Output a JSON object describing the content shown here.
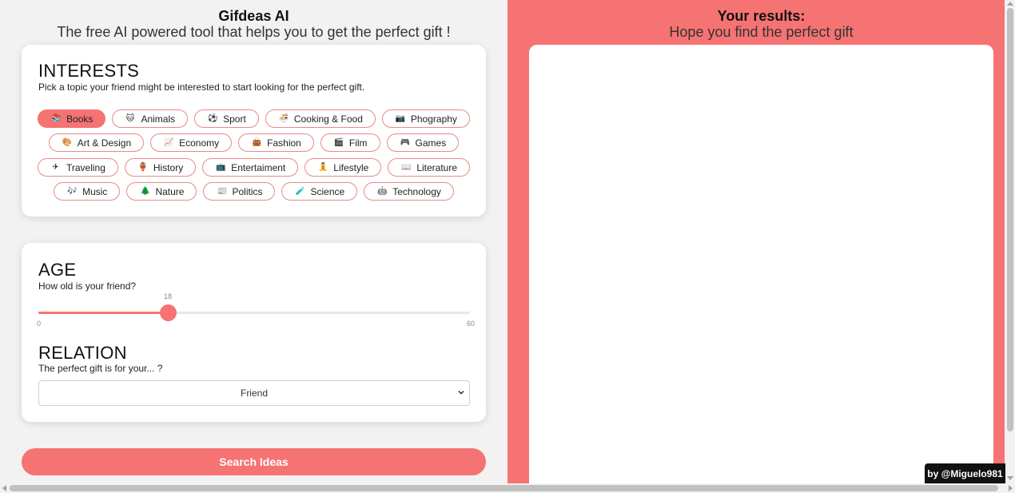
{
  "app": {
    "title": "Gifdeas AI",
    "subtitle": "The free AI powered tool that helps you to get the perfect gift !"
  },
  "interests": {
    "title": "INTERESTS",
    "description": "Pick a topic your friend might be interested to start looking for the perfect gift.",
    "rows": [
      [
        {
          "label": "Books",
          "icon": "books-icon",
          "glyph": "📚",
          "selected": true
        },
        {
          "label": "Animals",
          "icon": "cat-icon",
          "glyph": "🐱",
          "selected": false
        },
        {
          "label": "Sport",
          "icon": "soccer-ball-icon",
          "glyph": "⚽",
          "selected": false
        },
        {
          "label": "Cooking & Food",
          "icon": "food-bowl-icon",
          "glyph": "🍜",
          "selected": false
        },
        {
          "label": "Phography",
          "icon": "camera-icon",
          "glyph": "📷",
          "selected": false
        }
      ],
      [
        {
          "label": "Art & Design",
          "icon": "palette-icon",
          "glyph": "🎨",
          "selected": false
        },
        {
          "label": "Economy",
          "icon": "chart-increasing-icon",
          "glyph": "📈",
          "selected": false
        },
        {
          "label": "Fashion",
          "icon": "handbag-icon",
          "glyph": "👜",
          "selected": false
        },
        {
          "label": "Film",
          "icon": "clapper-board-icon",
          "glyph": "🎬",
          "selected": false
        },
        {
          "label": "Games",
          "icon": "game-controller-icon",
          "glyph": "🎮",
          "selected": false
        }
      ],
      [
        {
          "label": "Traveling",
          "icon": "airplane-icon",
          "glyph": "✈",
          "selected": false
        },
        {
          "label": "History",
          "icon": "amphora-icon",
          "glyph": "🏺",
          "selected": false
        },
        {
          "label": "Entertaiment",
          "icon": "television-icon",
          "glyph": "📺",
          "selected": false
        },
        {
          "label": "Lifestyle",
          "icon": "lifestyle-icon",
          "glyph": "🧘",
          "selected": false
        },
        {
          "label": "Literature",
          "icon": "open-book-icon",
          "glyph": "📖",
          "selected": false
        }
      ],
      [
        {
          "label": "Music",
          "icon": "music-notes-icon",
          "glyph": "🎶",
          "selected": false
        },
        {
          "label": "Nature",
          "icon": "tree-icon",
          "glyph": "🌲",
          "selected": false
        },
        {
          "label": "Politics",
          "icon": "newspaper-icon",
          "glyph": "📰",
          "selected": false
        },
        {
          "label": "Science",
          "icon": "test-tube-icon",
          "glyph": "🧪",
          "selected": false
        },
        {
          "label": "Technology",
          "icon": "robot-icon",
          "glyph": "🤖",
          "selected": false
        }
      ]
    ]
  },
  "age": {
    "title": "AGE",
    "description": "How old is your friend?",
    "value": "18",
    "min": "0",
    "max": "60"
  },
  "relation": {
    "title": "RELATION",
    "description": "The perfect gift is for your... ?",
    "selected": "Friend"
  },
  "search_button": "Search Ideas",
  "results": {
    "title": "Your results:",
    "subtitle": "Hope you find the perfect gift"
  },
  "credit": "by @Miguelo981",
  "colors": {
    "accent": "#f67373",
    "tag_border": "#e88a8a",
    "background": "#f2f2f2",
    "credit_bg": "#111111"
  }
}
